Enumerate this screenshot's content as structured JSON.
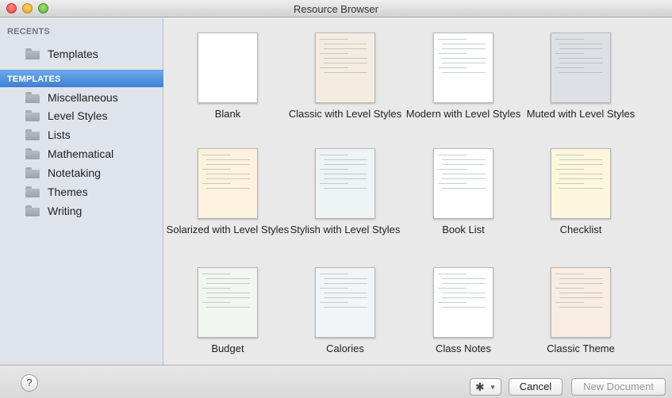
{
  "window": {
    "title": "Resource Browser"
  },
  "sidebar": {
    "recents_header": "RECENTS",
    "recents": [
      {
        "label": "Templates",
        "icon": "folder-icon"
      }
    ],
    "templates_header": "TEMPLATES",
    "templates": [
      {
        "label": "Miscellaneous",
        "icon": "folder-icon"
      },
      {
        "label": "Level Styles",
        "icon": "folder-icon"
      },
      {
        "label": "Lists",
        "icon": "folder-icon"
      },
      {
        "label": "Mathematical",
        "icon": "folder-icon"
      },
      {
        "label": "Notetaking",
        "icon": "folder-icon"
      },
      {
        "label": "Themes",
        "icon": "folder-icon"
      },
      {
        "label": "Writing",
        "icon": "folder-icon"
      }
    ]
  },
  "grid": {
    "items": [
      {
        "name": "Blank",
        "bg": "#ffffff"
      },
      {
        "name": "Classic with Level Styles",
        "bg": "#f4ece1"
      },
      {
        "name": "Modern with Level Styles",
        "bg": "#ffffff"
      },
      {
        "name": "Muted with Level Styles",
        "bg": "#dde0e4"
      },
      {
        "name": "Solarized with Level Styles",
        "bg": "#fdf2dd"
      },
      {
        "name": "Stylish with Level Styles",
        "bg": "#eef3f3"
      },
      {
        "name": "Book List",
        "bg": "#ffffff"
      },
      {
        "name": "Checklist",
        "bg": "#fcf6dc"
      },
      {
        "name": "Budget",
        "bg": "#f2f6f0"
      },
      {
        "name": "Calories",
        "bg": "#f2f5f7"
      },
      {
        "name": "Class Notes",
        "bg": "#ffffff"
      },
      {
        "name": "Classic Theme",
        "bg": "#f8ece3"
      }
    ]
  },
  "footer": {
    "help_label": "?",
    "gear_icon": "gear-icon",
    "cancel_label": "Cancel",
    "new_document_label": "New Document"
  },
  "colors": {
    "selection": "#3d80d2",
    "sidebar": "#dfe4ea"
  }
}
